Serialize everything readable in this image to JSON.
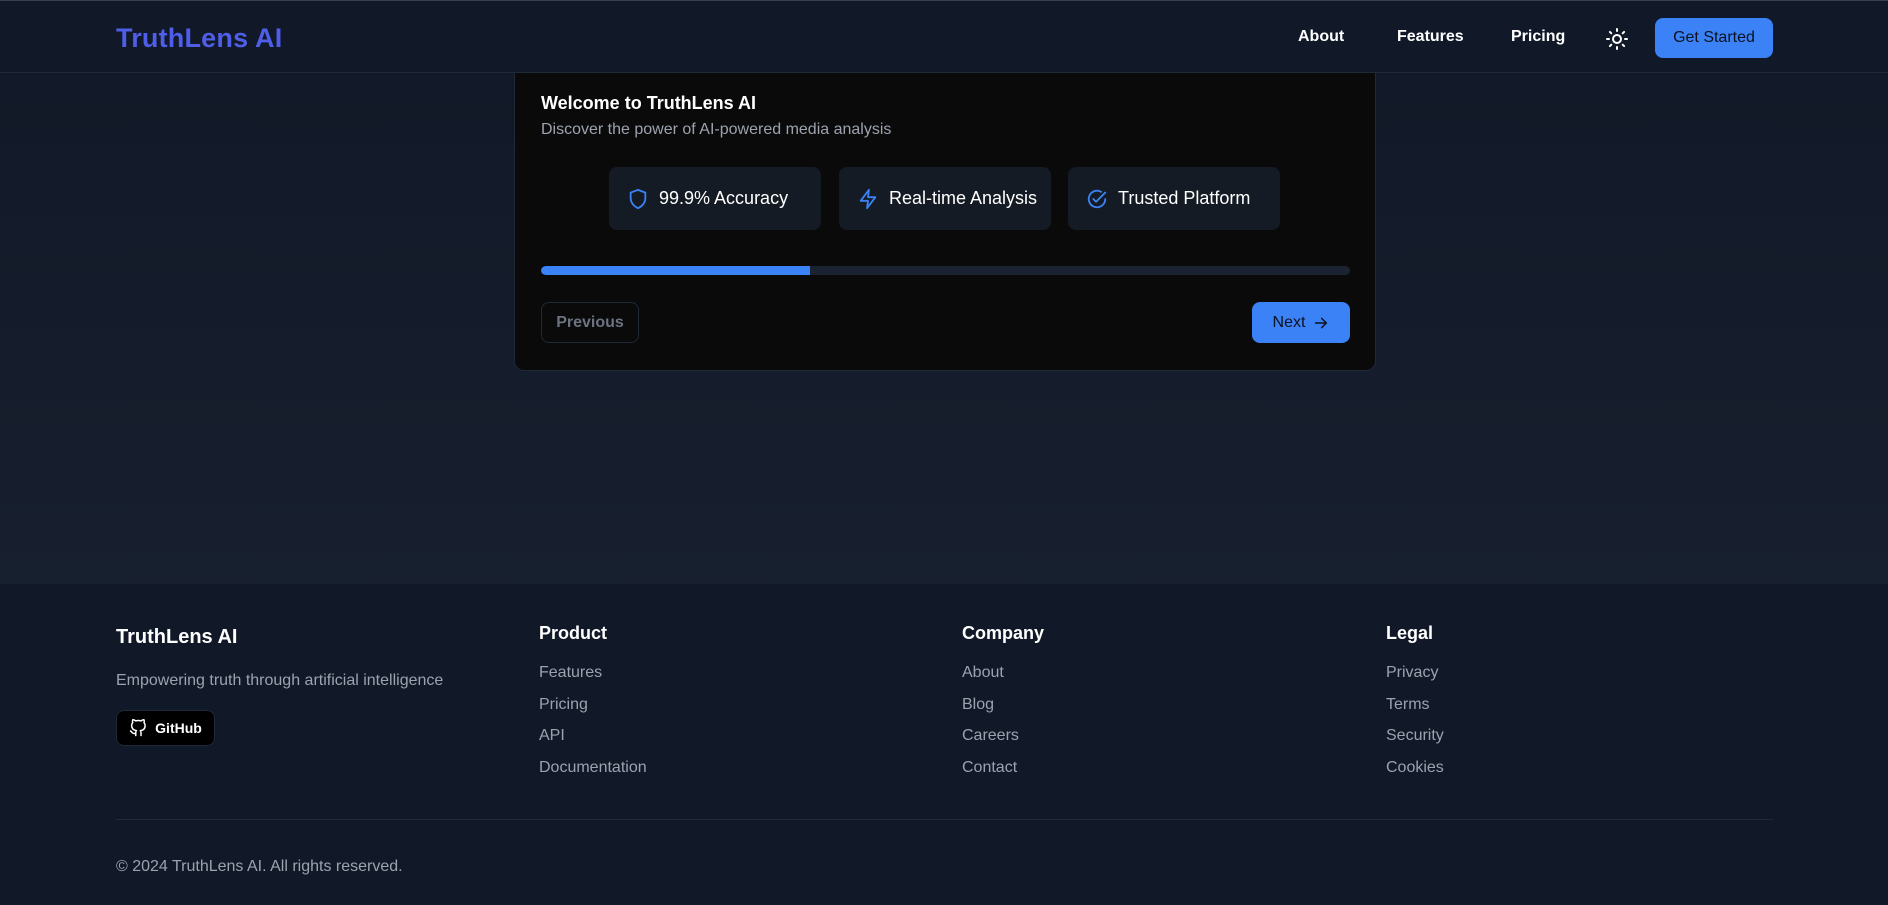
{
  "header": {
    "logo": "TruthLens AI",
    "nav": [
      "About",
      "Features",
      "Pricing"
    ],
    "theme_icon": "sun-icon",
    "cta": "Get Started"
  },
  "welcome": {
    "title": "Welcome to TruthLens AI",
    "subtitle": "Discover the power of AI-powered media analysis",
    "features": [
      {
        "label": "99.9% Accuracy",
        "icon": "shield-icon"
      },
      {
        "label": "Real-time Analysis",
        "icon": "lightning-icon"
      },
      {
        "label": "Trusted Platform",
        "icon": "check-circle-icon"
      }
    ],
    "progress_fraction": 0.333,
    "previous_label": "Previous",
    "next_label": "Next"
  },
  "footer": {
    "brand": "TruthLens AI",
    "tagline": "Empowering truth through artificial intelligence",
    "github_label": "GitHub",
    "columns": [
      {
        "title": "Product",
        "links": [
          "Features",
          "Pricing",
          "API",
          "Documentation"
        ]
      },
      {
        "title": "Company",
        "links": [
          "About",
          "Blog",
          "Careers",
          "Contact"
        ]
      },
      {
        "title": "Legal",
        "links": [
          "Privacy",
          "Terms",
          "Security",
          "Cookies"
        ]
      }
    ],
    "copyright": "© 2024 TruthLens AI. All rights reserved."
  },
  "colors": {
    "accent": "#3b82f6",
    "logo": "#4f5ee8",
    "background": "#111827",
    "card": "#0a0a0a"
  }
}
